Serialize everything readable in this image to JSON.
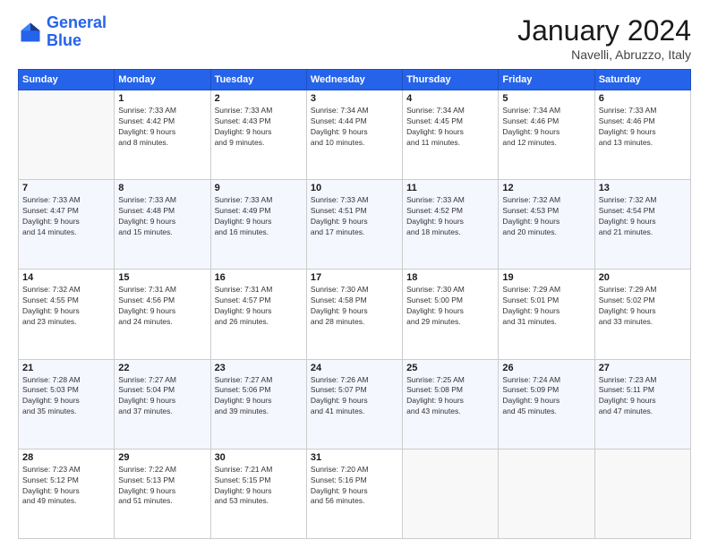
{
  "header": {
    "logo_line1": "General",
    "logo_line2": "Blue",
    "month": "January 2024",
    "location": "Navelli, Abruzzo, Italy"
  },
  "weekdays": [
    "Sunday",
    "Monday",
    "Tuesday",
    "Wednesday",
    "Thursday",
    "Friday",
    "Saturday"
  ],
  "weeks": [
    [
      {
        "day": "",
        "info": ""
      },
      {
        "day": "1",
        "info": "Sunrise: 7:33 AM\nSunset: 4:42 PM\nDaylight: 9 hours\nand 8 minutes."
      },
      {
        "day": "2",
        "info": "Sunrise: 7:33 AM\nSunset: 4:43 PM\nDaylight: 9 hours\nand 9 minutes."
      },
      {
        "day": "3",
        "info": "Sunrise: 7:34 AM\nSunset: 4:44 PM\nDaylight: 9 hours\nand 10 minutes."
      },
      {
        "day": "4",
        "info": "Sunrise: 7:34 AM\nSunset: 4:45 PM\nDaylight: 9 hours\nand 11 minutes."
      },
      {
        "day": "5",
        "info": "Sunrise: 7:34 AM\nSunset: 4:46 PM\nDaylight: 9 hours\nand 12 minutes."
      },
      {
        "day": "6",
        "info": "Sunrise: 7:33 AM\nSunset: 4:46 PM\nDaylight: 9 hours\nand 13 minutes."
      }
    ],
    [
      {
        "day": "7",
        "info": "Sunrise: 7:33 AM\nSunset: 4:47 PM\nDaylight: 9 hours\nand 14 minutes."
      },
      {
        "day": "8",
        "info": "Sunrise: 7:33 AM\nSunset: 4:48 PM\nDaylight: 9 hours\nand 15 minutes."
      },
      {
        "day": "9",
        "info": "Sunrise: 7:33 AM\nSunset: 4:49 PM\nDaylight: 9 hours\nand 16 minutes."
      },
      {
        "day": "10",
        "info": "Sunrise: 7:33 AM\nSunset: 4:51 PM\nDaylight: 9 hours\nand 17 minutes."
      },
      {
        "day": "11",
        "info": "Sunrise: 7:33 AM\nSunset: 4:52 PM\nDaylight: 9 hours\nand 18 minutes."
      },
      {
        "day": "12",
        "info": "Sunrise: 7:32 AM\nSunset: 4:53 PM\nDaylight: 9 hours\nand 20 minutes."
      },
      {
        "day": "13",
        "info": "Sunrise: 7:32 AM\nSunset: 4:54 PM\nDaylight: 9 hours\nand 21 minutes."
      }
    ],
    [
      {
        "day": "14",
        "info": "Sunrise: 7:32 AM\nSunset: 4:55 PM\nDaylight: 9 hours\nand 23 minutes."
      },
      {
        "day": "15",
        "info": "Sunrise: 7:31 AM\nSunset: 4:56 PM\nDaylight: 9 hours\nand 24 minutes."
      },
      {
        "day": "16",
        "info": "Sunrise: 7:31 AM\nSunset: 4:57 PM\nDaylight: 9 hours\nand 26 minutes."
      },
      {
        "day": "17",
        "info": "Sunrise: 7:30 AM\nSunset: 4:58 PM\nDaylight: 9 hours\nand 28 minutes."
      },
      {
        "day": "18",
        "info": "Sunrise: 7:30 AM\nSunset: 5:00 PM\nDaylight: 9 hours\nand 29 minutes."
      },
      {
        "day": "19",
        "info": "Sunrise: 7:29 AM\nSunset: 5:01 PM\nDaylight: 9 hours\nand 31 minutes."
      },
      {
        "day": "20",
        "info": "Sunrise: 7:29 AM\nSunset: 5:02 PM\nDaylight: 9 hours\nand 33 minutes."
      }
    ],
    [
      {
        "day": "21",
        "info": "Sunrise: 7:28 AM\nSunset: 5:03 PM\nDaylight: 9 hours\nand 35 minutes."
      },
      {
        "day": "22",
        "info": "Sunrise: 7:27 AM\nSunset: 5:04 PM\nDaylight: 9 hours\nand 37 minutes."
      },
      {
        "day": "23",
        "info": "Sunrise: 7:27 AM\nSunset: 5:06 PM\nDaylight: 9 hours\nand 39 minutes."
      },
      {
        "day": "24",
        "info": "Sunrise: 7:26 AM\nSunset: 5:07 PM\nDaylight: 9 hours\nand 41 minutes."
      },
      {
        "day": "25",
        "info": "Sunrise: 7:25 AM\nSunset: 5:08 PM\nDaylight: 9 hours\nand 43 minutes."
      },
      {
        "day": "26",
        "info": "Sunrise: 7:24 AM\nSunset: 5:09 PM\nDaylight: 9 hours\nand 45 minutes."
      },
      {
        "day": "27",
        "info": "Sunrise: 7:23 AM\nSunset: 5:11 PM\nDaylight: 9 hours\nand 47 minutes."
      }
    ],
    [
      {
        "day": "28",
        "info": "Sunrise: 7:23 AM\nSunset: 5:12 PM\nDaylight: 9 hours\nand 49 minutes."
      },
      {
        "day": "29",
        "info": "Sunrise: 7:22 AM\nSunset: 5:13 PM\nDaylight: 9 hours\nand 51 minutes."
      },
      {
        "day": "30",
        "info": "Sunrise: 7:21 AM\nSunset: 5:15 PM\nDaylight: 9 hours\nand 53 minutes."
      },
      {
        "day": "31",
        "info": "Sunrise: 7:20 AM\nSunset: 5:16 PM\nDaylight: 9 hours\nand 56 minutes."
      },
      {
        "day": "",
        "info": ""
      },
      {
        "day": "",
        "info": ""
      },
      {
        "day": "",
        "info": ""
      }
    ]
  ]
}
